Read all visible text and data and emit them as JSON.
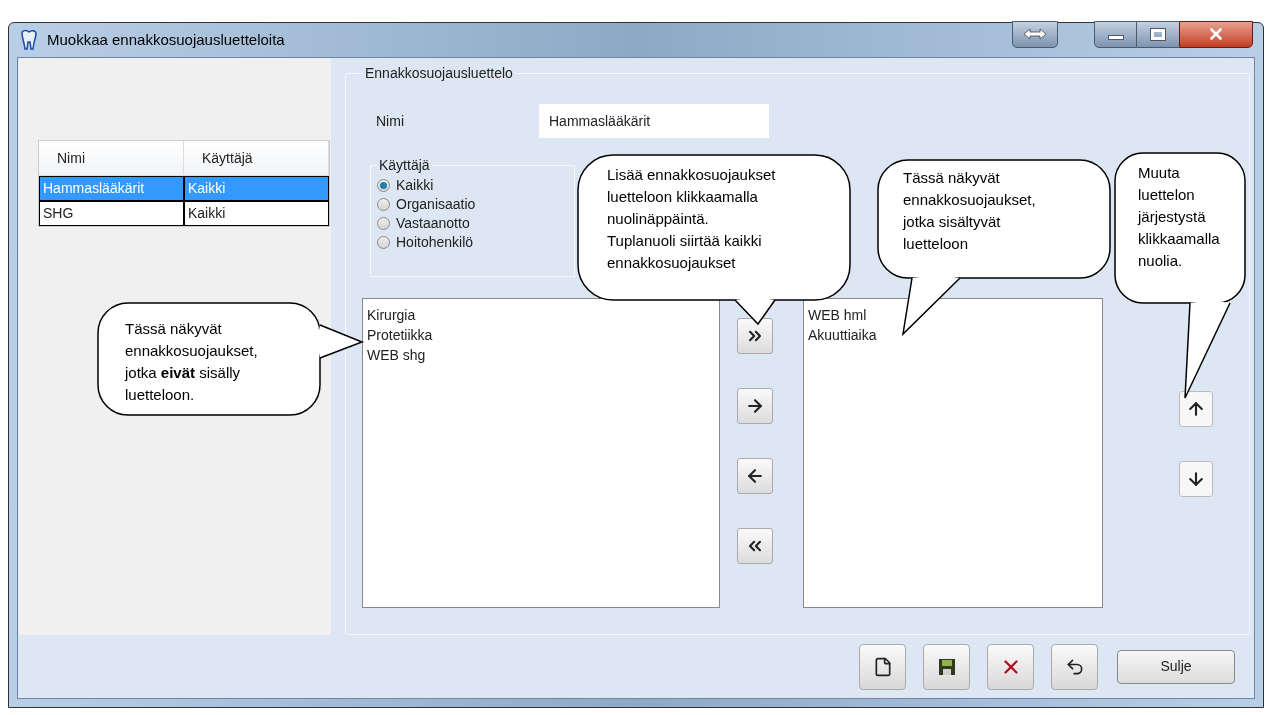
{
  "window": {
    "title": "Muokkaa ennakkosuojausluetteloita"
  },
  "table": {
    "columns": [
      "Nimi",
      "Käyttäjä"
    ],
    "rows": [
      {
        "cells": [
          "Hammaslääkärit",
          "Kaikki"
        ],
        "selected": true
      },
      {
        "cells": [
          "SHG",
          "Kaikki"
        ],
        "selected": false
      }
    ]
  },
  "group": {
    "title": "Ennakkosuojausluettelo",
    "name_label": "Nimi",
    "name_value": "Hammaslääkärit",
    "user_group": {
      "title": "Käyttäjä",
      "options": [
        {
          "label": "Kaikki",
          "selected": true
        },
        {
          "label": "Organisaatio",
          "selected": false
        },
        {
          "label": "Vastaanotto",
          "selected": false
        },
        {
          "label": "Hoitohenkilö",
          "selected": false
        }
      ]
    },
    "available_list": [
      "Kirurgia",
      "Protetiikka",
      "WEB shg"
    ],
    "transfer_buttons": [
      {
        "kind": "all-right"
      },
      {
        "kind": "right"
      },
      {
        "kind": "left"
      },
      {
        "kind": "all-left"
      }
    ],
    "selected_list": [
      "WEB hml",
      "Akuuttiaika"
    ],
    "order_buttons": [
      {
        "kind": "up"
      },
      {
        "kind": "down"
      }
    ]
  },
  "toolbar": [
    {
      "kind": "new"
    },
    {
      "kind": "save"
    },
    {
      "kind": "delete"
    },
    {
      "kind": "undo"
    }
  ],
  "close_button": "Sulje",
  "callouts": [
    {
      "text": "Tässä näkyvät\nennakkosuojaukset,\njotka **eivät** sisälly\nluetteloon."
    },
    {
      "text": "Lisää ennakkosuojaukset\nluetteloon klikkaamalla\nnuolinäppäintä.\nTuplanuoli siirtää kaikki\nennakkosuojaukset"
    },
    {
      "text": "Tässä näkyvät\nennakkosuojaukset,\njotka sisältyvät\nluetteloon"
    },
    {
      "text": "Muuta\nluettelon\njärjestystä\nklikkaamalla\nnuolia."
    }
  ]
}
